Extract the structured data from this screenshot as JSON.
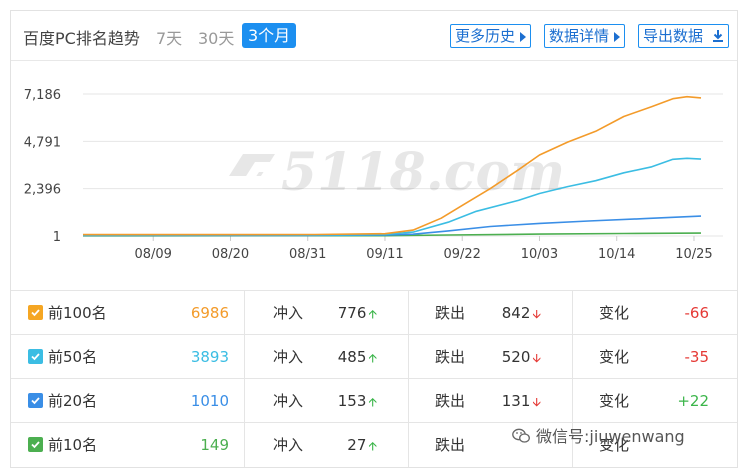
{
  "header": {
    "title": "百度PC排名趋势",
    "ranges": [
      "7天",
      "30天",
      "3个月"
    ],
    "active_range": "3个月",
    "buttons": {
      "history": "更多历史",
      "detail": "数据详情",
      "export": "导出数据"
    }
  },
  "watermark": {
    "text": "5118.com"
  },
  "chart_data": {
    "type": "line",
    "x_ticks": [
      "08/09",
      "08/20",
      "08/31",
      "09/11",
      "09/22",
      "10/03",
      "10/14",
      "10/25"
    ],
    "y_ticks": [
      "7,186",
      "4,791",
      "2,396",
      "1"
    ],
    "ylim": [
      1,
      7186
    ],
    "x_range": [
      "07/30",
      "10/26"
    ],
    "grid": true,
    "series": [
      {
        "name": "前100名",
        "color": "#f39b2a",
        "points": [
          [
            "07/30",
            70
          ],
          [
            "08/15",
            70
          ],
          [
            "09/01",
            75
          ],
          [
            "09/11",
            115
          ],
          [
            "09/15",
            300
          ],
          [
            "09/19",
            900
          ],
          [
            "09/22",
            1550
          ],
          [
            "09/26",
            2400
          ],
          [
            "09/30",
            3350
          ],
          [
            "10/03",
            4100
          ],
          [
            "10/07",
            4750
          ],
          [
            "10/11",
            5300
          ],
          [
            "10/15",
            6050
          ],
          [
            "10/19",
            6550
          ],
          [
            "10/22",
            6950
          ],
          [
            "10/24",
            7050
          ],
          [
            "10/26",
            6990
          ]
        ]
      },
      {
        "name": "前50名",
        "color": "#3bbde3",
        "points": [
          [
            "07/30",
            45
          ],
          [
            "08/20",
            50
          ],
          [
            "09/05",
            55
          ],
          [
            "09/11",
            80
          ],
          [
            "09/15",
            200
          ],
          [
            "09/20",
            700
          ],
          [
            "09/24",
            1250
          ],
          [
            "09/30",
            1800
          ],
          [
            "10/03",
            2150
          ],
          [
            "10/07",
            2500
          ],
          [
            "10/11",
            2800
          ],
          [
            "10/15",
            3200
          ],
          [
            "10/19",
            3500
          ],
          [
            "10/22",
            3880
          ],
          [
            "10/24",
            3930
          ],
          [
            "10/26",
            3893
          ]
        ]
      },
      {
        "name": "前20名",
        "color": "#3a8ee6",
        "points": [
          [
            "07/30",
            25
          ],
          [
            "08/31",
            30
          ],
          [
            "09/11",
            45
          ],
          [
            "09/15",
            90
          ],
          [
            "09/20",
            260
          ],
          [
            "09/26",
            480
          ],
          [
            "10/03",
            640
          ],
          [
            "10/10",
            760
          ],
          [
            "10/18",
            880
          ],
          [
            "10/26",
            1010
          ]
        ]
      },
      {
        "name": "前10名",
        "color": "#4caf50",
        "points": [
          [
            "07/30",
            12
          ],
          [
            "09/11",
            18
          ],
          [
            "09/20",
            50
          ],
          [
            "10/03",
            95
          ],
          [
            "10/15",
            125
          ],
          [
            "10/26",
            149
          ]
        ]
      }
    ]
  },
  "table": {
    "labels": {
      "in": "冲入",
      "out": "跌出",
      "change": "变化"
    },
    "rows": [
      {
        "name": "前100名",
        "value": "6986",
        "value_color": "#f39b2a",
        "check_color": "#f5a623",
        "in": "776",
        "out": "842",
        "change": "-66",
        "change_color": "#e53935"
      },
      {
        "name": "前50名",
        "value": "3893",
        "value_color": "#3bbde3",
        "check_color": "#3bbde3",
        "in": "485",
        "out": "520",
        "change": "-35",
        "change_color": "#e53935"
      },
      {
        "name": "前20名",
        "value": "1010",
        "value_color": "#3a8ee6",
        "check_color": "#3a8ee6",
        "in": "153",
        "out": "131",
        "change": "+22",
        "change_color": "#3bb54a"
      },
      {
        "name": "前10名",
        "value": "149",
        "value_color": "#4caf50",
        "check_color": "#4caf50",
        "in": "27",
        "out": "",
        "change": "",
        "change_color": "#e53935"
      }
    ]
  },
  "overlay": {
    "wechat_label": "微信号:jiuwenwang"
  },
  "icons": {
    "arrow_up": "arrow-up-icon",
    "arrow_down": "arrow-down-icon",
    "check": "checkbox-checked-icon",
    "wechat": "wechat-icon",
    "play": "triangle-right-icon",
    "download": "download-icon"
  }
}
